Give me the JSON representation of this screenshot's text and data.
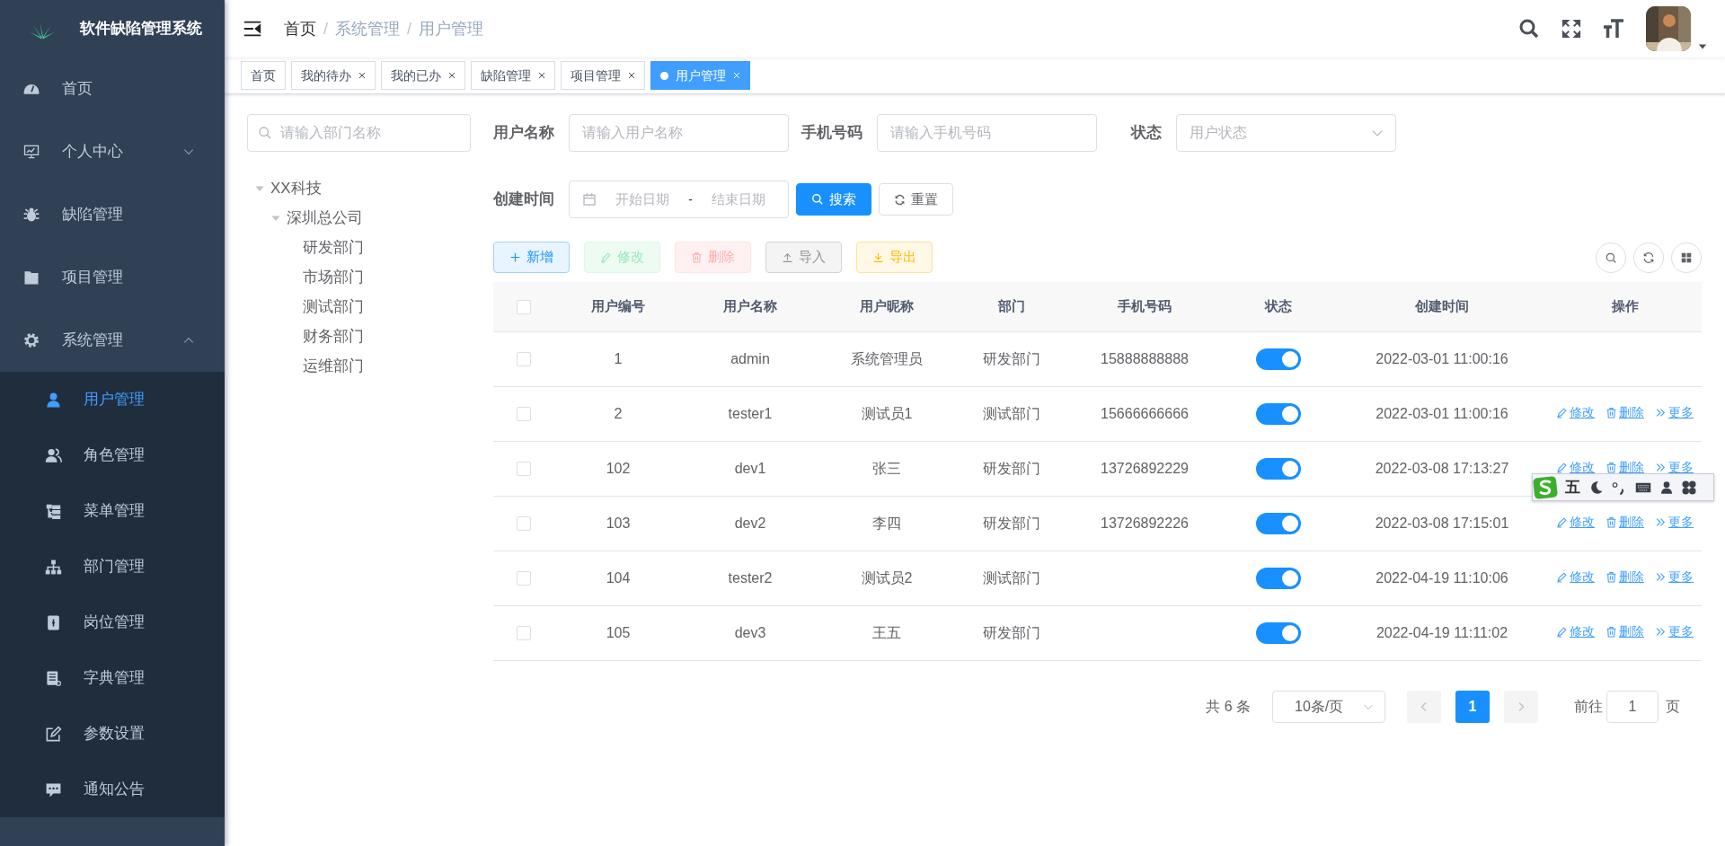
{
  "app": {
    "title": "软件缺陷管理系统"
  },
  "sidebar": {
    "items": [
      {
        "label": "首页"
      },
      {
        "label": "个人中心",
        "expanded": false
      },
      {
        "label": "缺陷管理"
      },
      {
        "label": "项目管理"
      },
      {
        "label": "系统管理",
        "expanded": true,
        "children": [
          {
            "label": "用户管理",
            "selected": true
          },
          {
            "label": "角色管理",
            "selected": false
          },
          {
            "label": "菜单管理",
            "selected": false
          },
          {
            "label": "部门管理",
            "selected": false
          },
          {
            "label": "岗位管理",
            "selected": false
          },
          {
            "label": "字典管理",
            "selected": false
          },
          {
            "label": "参数设置",
            "selected": false
          },
          {
            "label": "通知公告",
            "selected": false
          }
        ]
      }
    ]
  },
  "breadcrumb": [
    {
      "label": "首页"
    },
    {
      "separator": "/",
      "label": "系统管理"
    },
    {
      "separator": "/",
      "label": "用户管理"
    }
  ],
  "tags": [
    {
      "label": "首页",
      "closable": false,
      "selected": false
    },
    {
      "label": "我的待办",
      "closable": true,
      "selected": false
    },
    {
      "label": "我的已办",
      "closable": true,
      "selected": false
    },
    {
      "label": "缺陷管理",
      "closable": true,
      "selected": false
    },
    {
      "label": "项目管理",
      "closable": true,
      "selected": false
    },
    {
      "label": "用户管理",
      "closable": true,
      "selected": true
    }
  ],
  "dept_tree": {
    "placeholder": "请输入部门名称",
    "nodes": [
      {
        "label": "XX科技",
        "expanded": true,
        "children": [
          {
            "label": "深圳总公司",
            "expanded": true,
            "children": [
              {
                "label": "研发部门"
              },
              {
                "label": "市场部门"
              },
              {
                "label": "测试部门"
              },
              {
                "label": "财务部门"
              },
              {
                "label": "运维部门"
              }
            ]
          }
        ]
      }
    ]
  },
  "filters": [
    {
      "kind": "text",
      "label": "用户名称",
      "placeholder": "请输入用户名称"
    },
    {
      "kind": "text",
      "label": "手机号码",
      "placeholder": "请输入手机号码"
    },
    {
      "kind": "select",
      "label": "状态",
      "placeholder": "用户状态"
    },
    {
      "kind": "daterange",
      "label": "创建时间",
      "placeholder": "开始日期",
      "separator": "-",
      "end_placeholder": "结束日期"
    }
  ],
  "search_button": "搜索",
  "reset_button": "重置",
  "toolbar": [
    {
      "label": "新增",
      "kind": "primary",
      "disabled": false
    },
    {
      "label": "修改",
      "kind": "success",
      "disabled": true
    },
    {
      "label": "删除",
      "kind": "danger",
      "disabled": true
    },
    {
      "label": "导入",
      "kind": "info",
      "disabled": false
    },
    {
      "label": "导出",
      "kind": "warning",
      "disabled": false
    }
  ],
  "table": {
    "all_selected": false,
    "columns": [
      "用户编号",
      "用户名称",
      "用户昵称",
      "部门",
      "手机号码",
      "状态",
      "创建时间",
      "操作"
    ],
    "rows": [
      {
        "selected": false,
        "cells": [
          "1",
          "admin",
          "系统管理员",
          "研发部门",
          "15888888888"
        ],
        "enabled": true,
        "created": "2022-03-01 11:00:16",
        "actions": []
      },
      {
        "selected": false,
        "cells": [
          "2",
          "tester1",
          "测试员1",
          "测试部门",
          "15666666666"
        ],
        "enabled": true,
        "created": "2022-03-01 11:00:16",
        "actions": [
          "修改",
          "删除",
          "更多"
        ]
      },
      {
        "selected": false,
        "cells": [
          "102",
          "dev1",
          "张三",
          "研发部门",
          "13726892229"
        ],
        "enabled": true,
        "created": "2022-03-08 17:13:27",
        "actions": [
          "修改",
          "删除",
          "更多"
        ]
      },
      {
        "selected": false,
        "cells": [
          "103",
          "dev2",
          "李四",
          "研发部门",
          "13726892226"
        ],
        "enabled": true,
        "created": "2022-03-08 17:15:01",
        "actions": [
          "修改",
          "删除",
          "更多"
        ]
      },
      {
        "selected": false,
        "cells": [
          "104",
          "tester2",
          "测试员2",
          "测试部门",
          ""
        ],
        "enabled": true,
        "created": "2022-04-19 11:10:06",
        "actions": [
          "修改",
          "删除",
          "更多"
        ]
      },
      {
        "selected": false,
        "cells": [
          "105",
          "dev3",
          "王五",
          "研发部门",
          ""
        ],
        "enabled": true,
        "created": "2022-04-19 11:11:02",
        "actions": [
          "修改",
          "删除",
          "更多"
        ]
      }
    ]
  },
  "pagination": {
    "total": "共 6 条",
    "page_size": "10条/页",
    "pages": [
      {
        "label": "1",
        "selected": true
      }
    ],
    "goto_label": "前往",
    "goto_value": "1",
    "goto_suffix": "页"
  },
  "ime_toolbar": {
    "mode": "五"
  }
}
